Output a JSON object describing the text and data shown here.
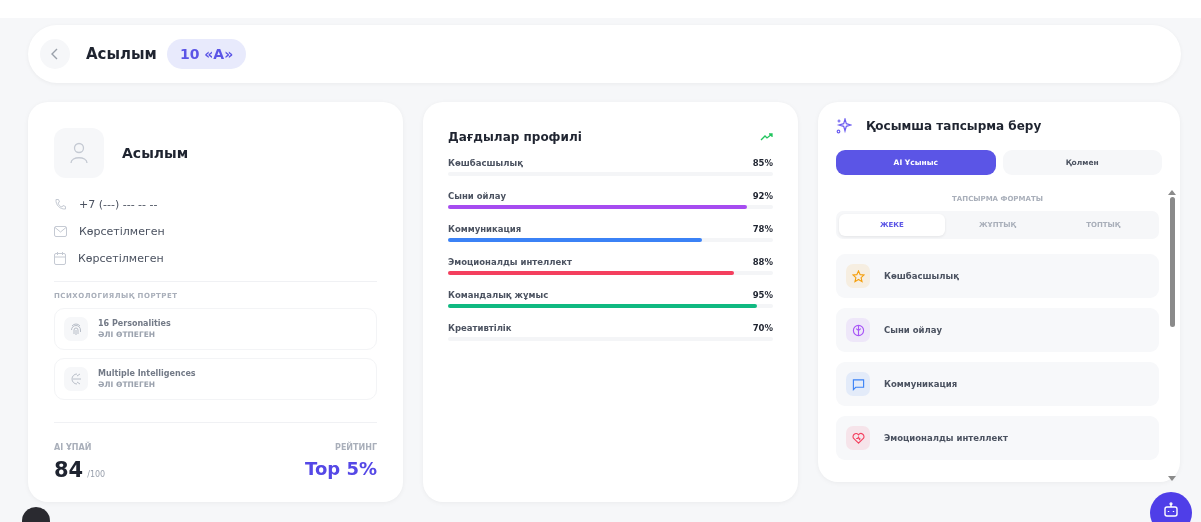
{
  "header": {
    "title": "Асылым",
    "class_badge": "10 «А»"
  },
  "profile": {
    "name": "Асылым",
    "contacts": [
      {
        "kind": "phone",
        "text": "+7 (---) --- -- --"
      },
      {
        "kind": "mail",
        "text": "Көрсетілмеген"
      },
      {
        "kind": "calendar",
        "text": "Көрсетілмеген"
      }
    ],
    "portrait_label": "ПСИХОЛОГИЯЛЫҚ ПОРТРЕТ",
    "tests": [
      {
        "kind": "fingerprint",
        "name": "16 Personalities",
        "status": "ӘЛІ ӨТПЕГЕН"
      },
      {
        "kind": "brain",
        "name": "Multiple Intelligences",
        "status": "ӘЛІ ӨТПЕГЕН"
      }
    ],
    "score_label": "AI ҰПАЙ",
    "score": "84",
    "score_max": "/100",
    "rating_label": "РЕЙТИНГ",
    "rating": "Top 5%"
  },
  "skills": {
    "title": "Дағдылар профилі",
    "items": [
      {
        "name": "Көшбасшылық",
        "value": "85%"
      },
      {
        "name": "Сыни ойлау",
        "value": "92%",
        "level": 0.92,
        "color": "#a64cf0"
      },
      {
        "name": "Коммуникация",
        "value": "78%",
        "level": 0.78,
        "color": "#3b82f6"
      },
      {
        "name": "Эмоционалды интеллект",
        "value": "88%",
        "level": 0.88,
        "color": "#f43f5e"
      },
      {
        "name": "Командалық жұмыс",
        "value": "95%",
        "level": 0.95,
        "color": "#10b981"
      },
      {
        "name": "Креативтілік",
        "value": "70%"
      }
    ]
  },
  "assign": {
    "title": "Қосымша тапсырма беру",
    "modes": [
      {
        "label": "AI Ұсыныс",
        "selected": true
      },
      {
        "label": "Қолмен",
        "selected": false
      }
    ],
    "format_label": "ТАПСЫРМА ФОРМАТЫ",
    "formats": [
      {
        "label": "ЖЕКЕ",
        "selected": true
      },
      {
        "label": "ЖҰПТЫҚ",
        "selected": false
      },
      {
        "label": "ТОПТЫҚ",
        "selected": false
      }
    ],
    "options": [
      {
        "kind": "star",
        "label": "Көшбасшылық",
        "color": "#f59e0b"
      },
      {
        "kind": "brain",
        "label": "Сыни ойлау",
        "color": "#a855f7"
      },
      {
        "kind": "chat",
        "label": "Коммуникация",
        "color": "#3b82f6"
      },
      {
        "kind": "heart",
        "label": "Эмоционалды интеллект",
        "color": "#f43f5e"
      }
    ]
  }
}
